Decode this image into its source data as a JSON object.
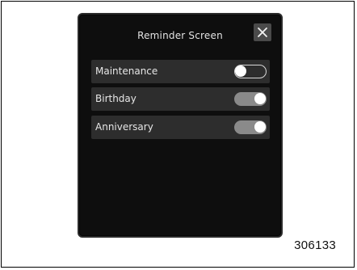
{
  "window": {
    "title": "Reminder Screen"
  },
  "close_button": {
    "icon": "close-icon"
  },
  "settings": [
    {
      "label": "Maintenance",
      "enabled": false
    },
    {
      "label": "Birthday",
      "enabled": true
    },
    {
      "label": "Anniversary",
      "enabled": true
    }
  ],
  "figure": {
    "number": "306133"
  },
  "colors": {
    "panel_background": "#0e0e0e",
    "row_background": "#2d2d2d",
    "toggle_on": "#8a8a8a",
    "text": "#e6e6e6"
  }
}
